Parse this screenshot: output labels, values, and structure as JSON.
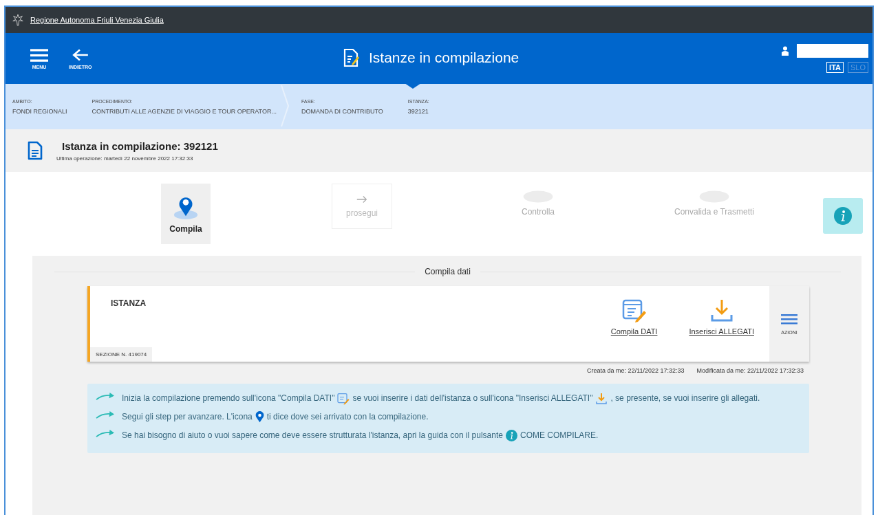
{
  "topbar": {
    "site_name": "Regione Autonoma Friuli Venezia Giulia"
  },
  "header": {
    "menu_label": "MENU",
    "back_label": "INDIETRO",
    "title": "Istanze in compilazione",
    "languages": [
      {
        "label": "ITA",
        "selected": true
      },
      {
        "label": "SLO",
        "selected": false
      }
    ]
  },
  "breadcrumb": [
    {
      "label": "AMBITO:",
      "value": "FONDI REGIONALI"
    },
    {
      "label": "PROCEDIMENTO:",
      "value": "CONTRIBUTI ALLE AGENZIE DI VIAGGIO E TOUR OPERATOR..."
    },
    {
      "label": "FASE:",
      "value": "DOMANDA DI CONTRIBUTO"
    },
    {
      "label": "ISTANZA:",
      "value": "392121"
    }
  ],
  "instance": {
    "title": "Istanza in compilazione: 392121",
    "last_operation": "Ultima operazione: martedì 22 novembre 2022 17:32:33"
  },
  "steps": [
    {
      "kind": "step",
      "label": "Compila",
      "selected": true
    },
    {
      "kind": "next",
      "label": "prosegui"
    },
    {
      "kind": "step",
      "label": "Controlla",
      "selected": false
    },
    {
      "kind": "step",
      "label": "Convalida e Trasmetti",
      "selected": false
    }
  ],
  "section": {
    "title": "Compila dati",
    "card": {
      "title": "ISTANZA",
      "section_number": "SEZIONE N. 419074",
      "actions": [
        {
          "kind": "edit",
          "label": "Compila DATI"
        },
        {
          "kind": "upload",
          "label": "Inserisci ALLEGATI"
        }
      ],
      "menu_label": "AZIONI"
    },
    "created": "Creata da me: 22/11/2022 17:32:33",
    "modified": "Modificata da me: 22/11/2022 17:32:33"
  },
  "tips": [
    {
      "parts": [
        "Inizia la compilazione premendo sull'icona \"Compila DATI\"",
        "se vuoi inserire i dati dell'istanza o sull'icona \"Inserisci ALLEGATI\"",
        ", se presente, se vuoi inserire gli allegati."
      ]
    },
    {
      "parts": [
        "Segui gli step per avanzare. L'icona",
        "ti dice dove sei arrivato con la compilazione."
      ]
    },
    {
      "parts": [
        "Se hai bisogno di aiuto o vuoi sapere come deve essere strutturata l'istanza, apri la guida con il pulsante",
        "COME COMPILARE."
      ]
    }
  ]
}
